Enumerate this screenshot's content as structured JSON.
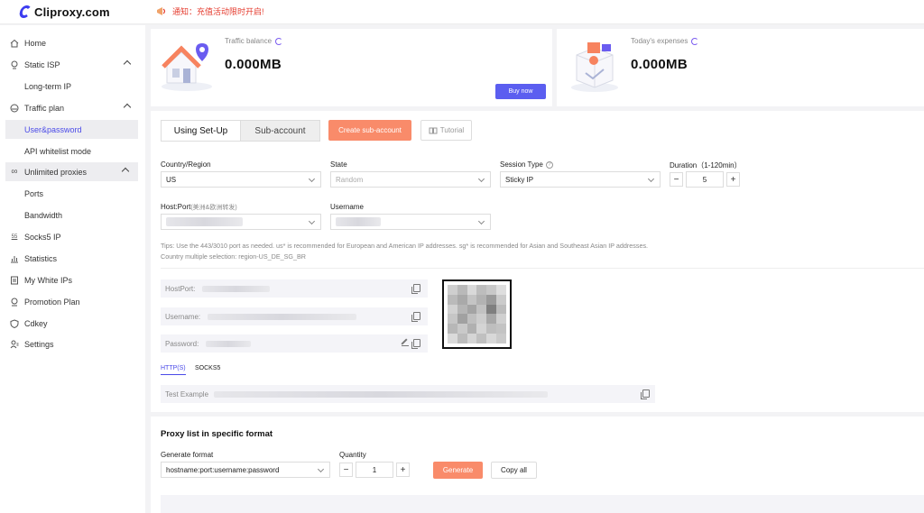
{
  "app": {
    "logo": "Cliproxy.com"
  },
  "notice": {
    "text": "通知：充值活动限时开启!"
  },
  "sidebar": {
    "items": [
      {
        "label": "Home"
      },
      {
        "label": "Static ISP"
      },
      {
        "label": "Long-term IP"
      },
      {
        "label": "Traffic plan"
      },
      {
        "label": "User&password"
      },
      {
        "label": "API whitelist mode"
      },
      {
        "label": "Unlimited proxies"
      },
      {
        "label": "Ports"
      },
      {
        "label": "Bandwidth"
      },
      {
        "label": "Socks5 IP"
      },
      {
        "label": "Statistics"
      },
      {
        "label": "My White IPs"
      },
      {
        "label": "Promotion Plan"
      },
      {
        "label": "Cdkey"
      },
      {
        "label": "Settings"
      }
    ]
  },
  "cards": {
    "traffic": {
      "label": "Traffic balance",
      "value": "0.000MB",
      "button": "Buy now"
    },
    "expenses": {
      "label": "Today's expenses",
      "value": "0.000MB"
    }
  },
  "tabs": {
    "setup": "Using Set-Up",
    "subaccount": "Sub-account"
  },
  "buttons": {
    "create_sub": "Create sub-account",
    "tutorial": "Tutorial"
  },
  "form": {
    "country_label": "Country/Region",
    "country_value": "US",
    "state_label": "State",
    "state_placeholder": "Random",
    "session_label": "Session Type",
    "session_value": "Sticky IP",
    "duration_label": "Duration（1-120min）",
    "duration_value": "5",
    "hostport_label": "Host:Port",
    "hostport_hint": "(美洲&欧洲转发)",
    "username_label": "Username"
  },
  "tips": {
    "line1": "Tips: Use the 443/3010 port as needed. us* is recommended for European and American IP addresses. sg* is recommended for Asian and Southeast Asian IP addresses.",
    "line2": "Country multiple selection: region-US_DE_SG_BR"
  },
  "credentials": {
    "hostport": "HostPort:",
    "username": "Username:",
    "password": "Password:"
  },
  "protocols": {
    "http": "HTTP(S)",
    "socks": "SOCKS5"
  },
  "test_example": "Test Example",
  "proxy_list": {
    "title": "Proxy list in specific format",
    "format_label": "Generate format",
    "format_value": "hostname:port:username:password",
    "quantity_label": "Quantity",
    "quantity_value": "1",
    "generate": "Generate",
    "copy_all": "Copy all"
  },
  "colors": {
    "accent": "#4a4ae8",
    "orange": "#f98b6a",
    "buy": "#5b5ef0",
    "notice": "#e53d30"
  }
}
